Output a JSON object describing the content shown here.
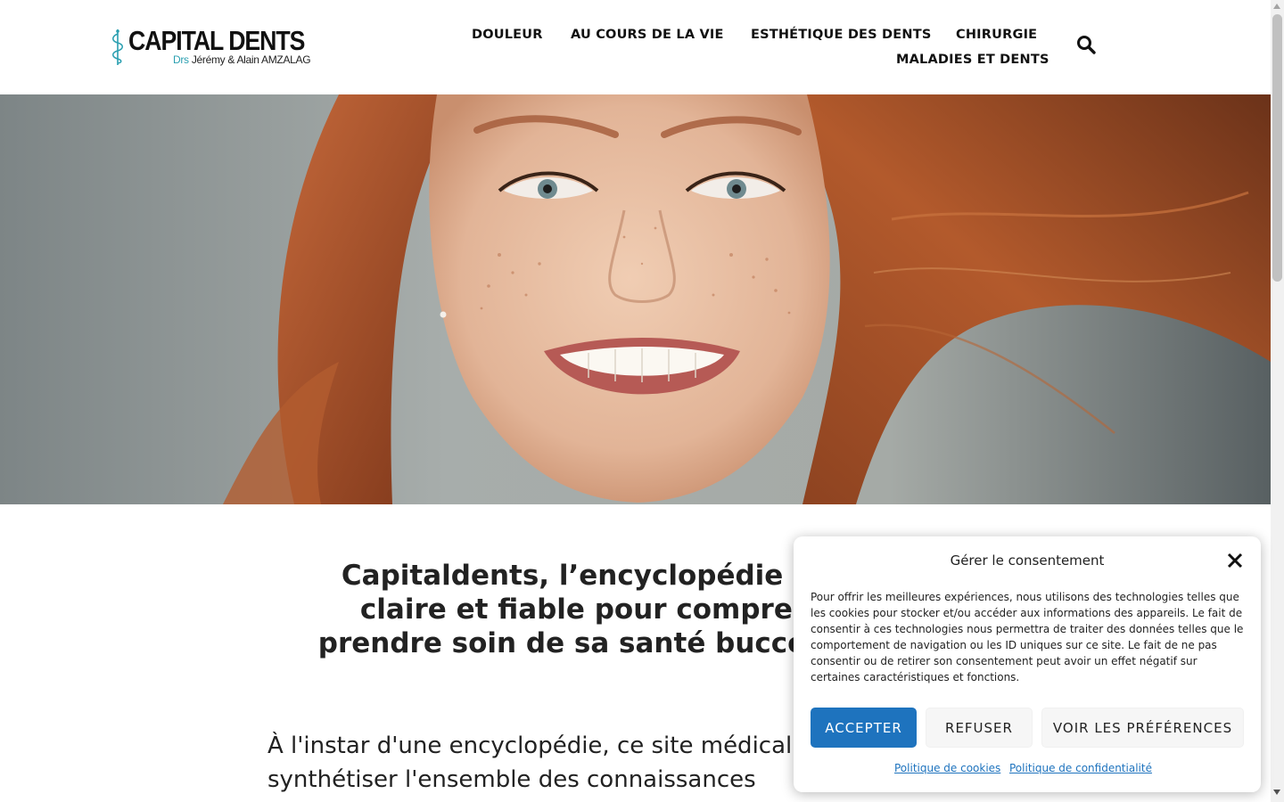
{
  "header": {
    "logo": {
      "title": "CAPITAL DENTS",
      "subtitle_prefix": "Drs",
      "subtitle_names": "Jérémy & Alain AMZALAG"
    },
    "nav": [
      {
        "label": "DOULEUR"
      },
      {
        "label": "AU COURS DE LA VIE"
      },
      {
        "label": "ESTHÉTIQUE DES DENTS"
      },
      {
        "label": "CHIRURGIE"
      },
      {
        "label": "MALADIES ET DENTS"
      }
    ],
    "search_icon": "search-icon"
  },
  "hero": {
    "image": "smiling-woman-red-hair-photo"
  },
  "main": {
    "title": "Capitaldents, l’encyclopédie dentaire claire et fiable pour comprendre et prendre soin de sa santé bucco dentaire",
    "intro": "À l'instar d'une encyclopédie, ce site médical vise à synthétiser l'ensemble des connaissances"
  },
  "consent": {
    "title": "Gérer le consentement",
    "close_icon": "close-icon",
    "text": "Pour offrir les meilleures expériences, nous utilisons des technologies telles que les cookies pour stocker et/ou accéder aux informations des appareils. Le fait de consentir à ces technologies nous permettra de traiter des données telles que le comportement de navigation ou les ID uniques sur ce site. Le fait de ne pas consentir ou de retirer son consentement peut avoir un effet négatif sur certaines caractéristiques et fonctions.",
    "buttons": {
      "accept": "ACCEPTER",
      "refuse": "REFUSER",
      "preferences": "VOIR LES PRÉFÉRENCES"
    },
    "links": {
      "cookies": "Politique de cookies",
      "privacy": "Politique de confidentialité"
    }
  },
  "colors": {
    "accent": "#1e73be",
    "logo_teal": "#2a9fb0",
    "text": "#222222"
  }
}
